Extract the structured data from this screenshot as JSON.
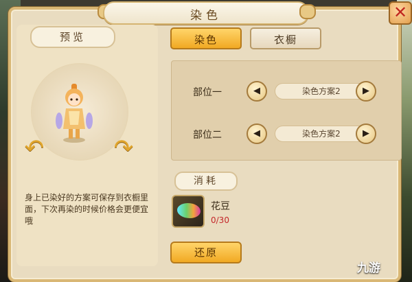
{
  "window": {
    "title": "染色",
    "close_label": "✕"
  },
  "preview": {
    "label": "预览",
    "rotate_left": "↶",
    "rotate_right": "↷",
    "hint": "身上已染好的方案可保存到衣橱里面，下次再染的时候价格会更便宜哦"
  },
  "tabs": [
    {
      "label": "染色",
      "active": true
    },
    {
      "label": "衣橱",
      "active": false
    }
  ],
  "parts": [
    {
      "label": "部位一",
      "value": "染色方案2"
    },
    {
      "label": "部位二",
      "value": "染色方案2"
    }
  ],
  "cost": {
    "label": "消耗",
    "item_name": "花豆",
    "item_count": "0/30"
  },
  "actions": {
    "restore_label": "还原"
  },
  "watermark": {
    "text": "九游"
  },
  "colors": {
    "accent": "#f1a923",
    "panel": "#e9dcc0",
    "warning_text": "#c4262a"
  }
}
